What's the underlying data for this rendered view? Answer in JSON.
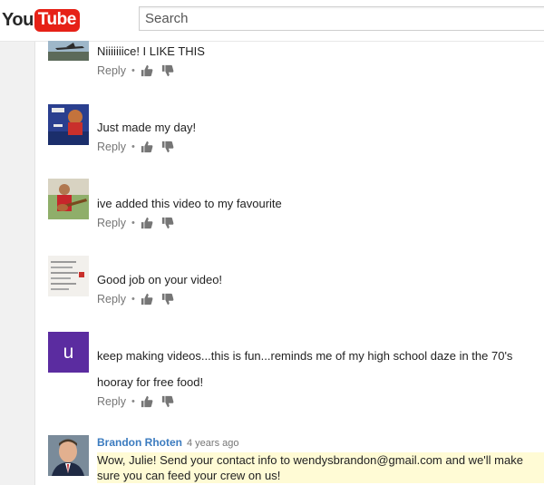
{
  "header": {
    "logo_you": "You",
    "logo_tube": "Tube",
    "search_placeholder": "Search"
  },
  "colors": {
    "brand_red": "#e62117",
    "author_link": "#3b7bbf",
    "highlight": "#fffbd5",
    "avatar_purple": "#5b2ca0"
  },
  "comments": [
    {
      "text": "Niiiiiiice! I LIKE THIS",
      "reply": "Reply",
      "avatar": "airplane-photo"
    },
    {
      "text": "Just made my day!",
      "reply": "Reply",
      "avatar": "cartoon-photo"
    },
    {
      "text": "ive added this video to my favourite",
      "reply": "Reply",
      "avatar": "guitarist-photo"
    },
    {
      "text": "Good job on your video!",
      "reply": "Reply",
      "avatar": "document-photo"
    },
    {
      "text": "keep making videos...this is fun...reminds me of my high school daze in the 70's",
      "text2": "hooray for free food!",
      "reply": "Reply",
      "avatar_letter": "u"
    },
    {
      "author": "Brandon Rhoten",
      "time": "4 years ago",
      "text": "Wow, Julie! Send your contact info to wendysbrandon@gmail.com and we'll make sure you can feed your crew on us!",
      "avatar": "man-portrait"
    }
  ]
}
